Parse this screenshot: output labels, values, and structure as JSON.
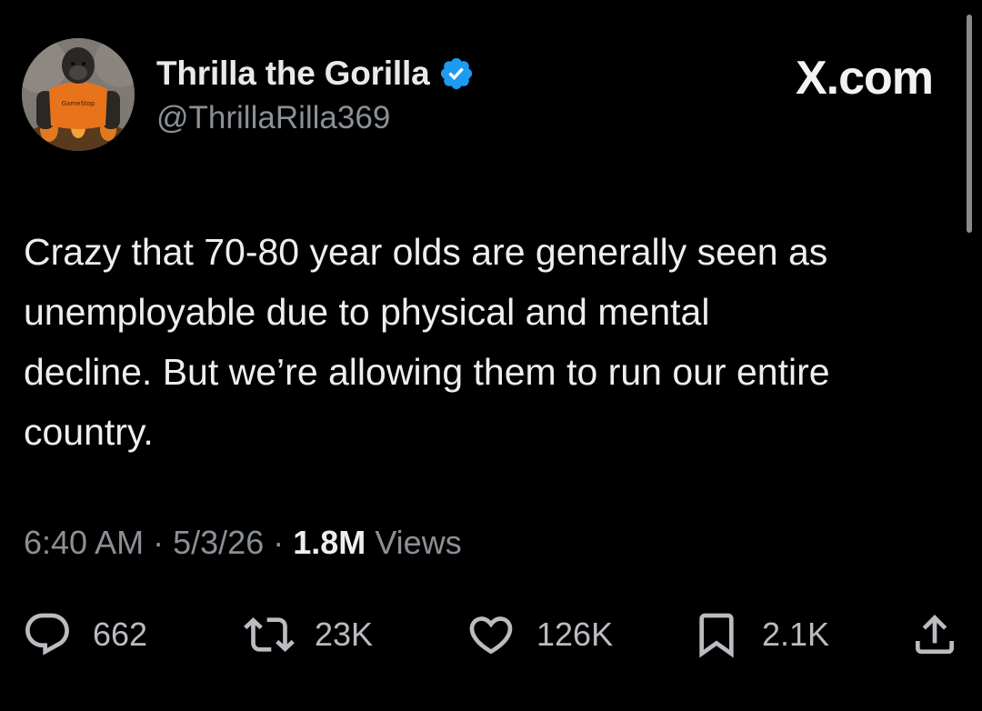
{
  "author": {
    "display_name": "Thrilla the Gorilla",
    "handle": "@ThrillaRilla369",
    "verified": true,
    "avatar_shirt_text": "GameStop"
  },
  "source": {
    "label": "X.com"
  },
  "tweet": {
    "text": "Crazy that 70-80 year olds are generally seen as\nunemployable due to physical and mental\ndecline. But we’re allowing them to run our entire\ncountry.",
    "time": "6:40 AM",
    "date": "5/3/26",
    "separator": "·",
    "views_count": "1.8M",
    "views_label": "Views"
  },
  "actions": {
    "replies": "662",
    "reposts": "23K",
    "likes": "126K",
    "bookmarks": "2.1K"
  },
  "colors": {
    "background": "#000000",
    "text_primary": "#e7e9ea",
    "text_secondary": "#8b9096",
    "verified_badge": "#1d9bf0",
    "icon": "#b9bcc0"
  },
  "icons": {
    "reply": "speech-bubble-icon",
    "repost": "repost-arrows-icon",
    "like": "heart-icon",
    "bookmark": "bookmark-icon",
    "share": "share-upload-icon",
    "verified": "verified-badge-icon"
  }
}
